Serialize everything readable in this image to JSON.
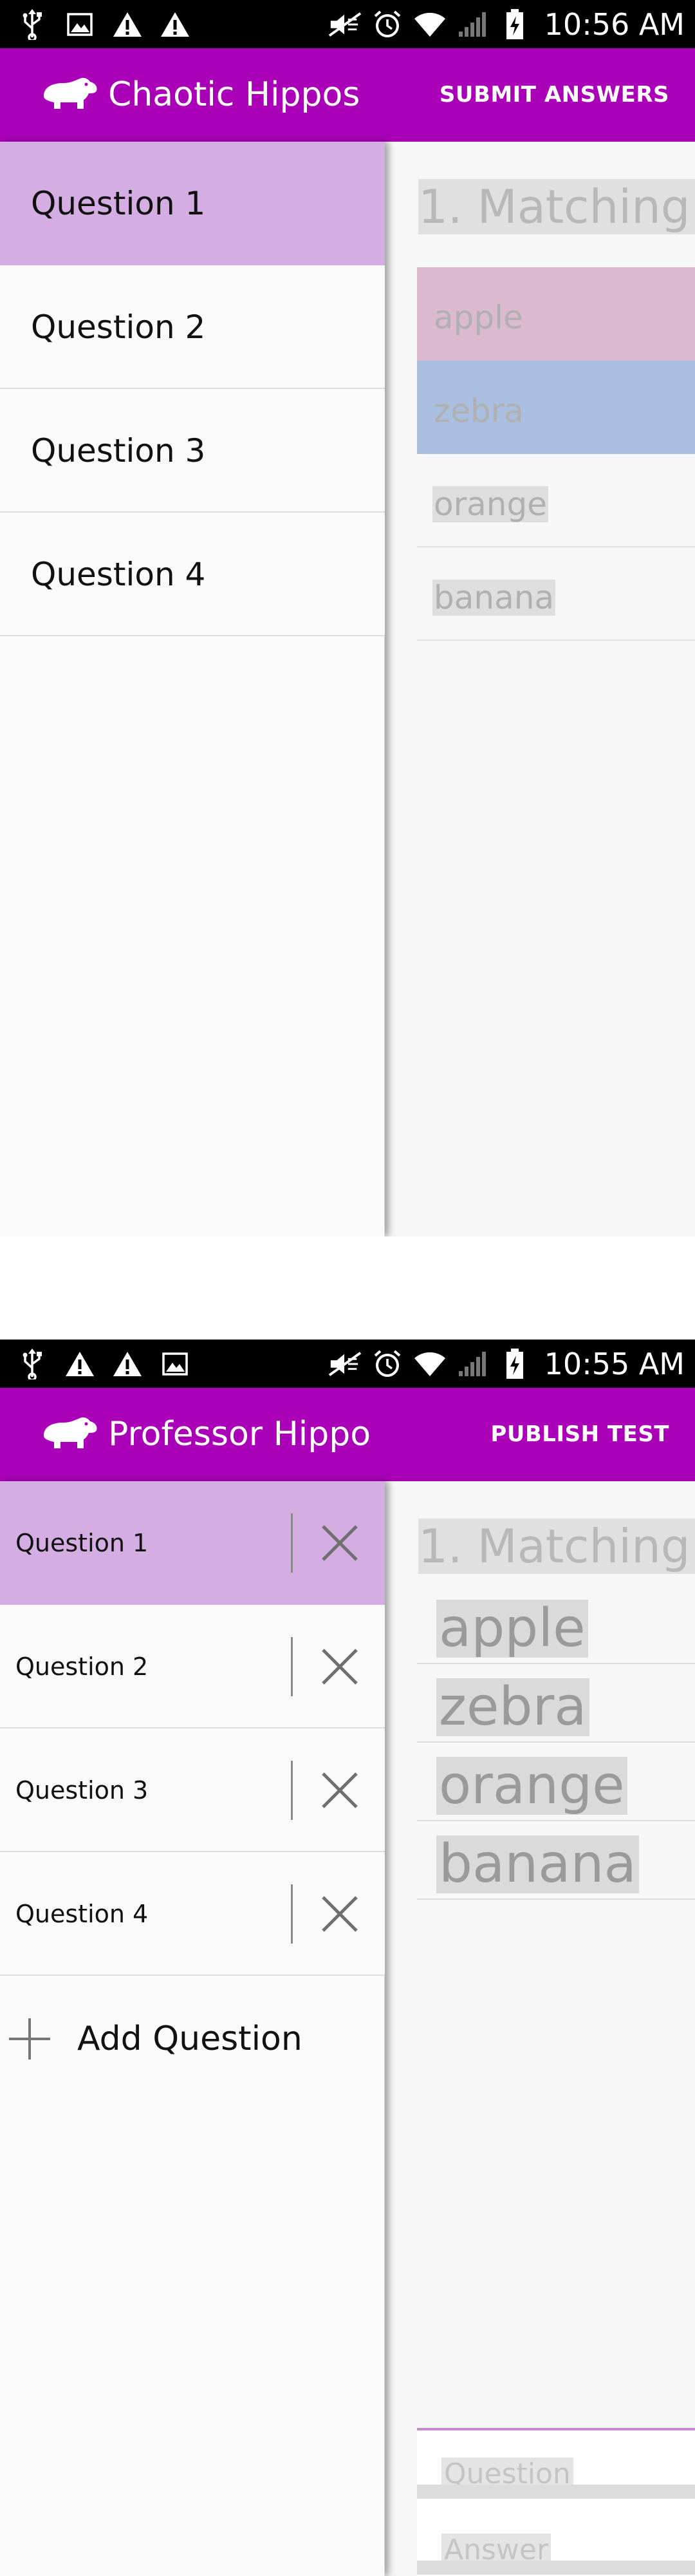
{
  "colors": {
    "appbar": "#aa00b8",
    "active_item": "#d4ade2",
    "match_pink": "#dbb9cf",
    "match_blue": "#aabfdf",
    "accent_line": "#c78bd3"
  },
  "screens": [
    {
      "status": {
        "time": "10:56 AM",
        "left_icons": [
          "usb-icon",
          "image-icon",
          "warning-icon",
          "warning-icon"
        ],
        "right_icons": [
          "mute-icon",
          "alarm-icon",
          "wifi-icon",
          "signal-icon",
          "battery-icon"
        ]
      },
      "appbar": {
        "logo_icon": "hippo-icon",
        "title": "Chaotic Hippos",
        "action": "SUBMIT ANSWERS"
      },
      "drawer": {
        "items": [
          {
            "label": "Question 1",
            "active": true
          },
          {
            "label": "Question 2",
            "active": false
          },
          {
            "label": "Question 3",
            "active": false
          },
          {
            "label": "Question 4",
            "active": false
          }
        ]
      },
      "content": {
        "heading": "1. Matching",
        "options": [
          {
            "text": "apple",
            "color": "#dbb9cf"
          },
          {
            "text": "zebra",
            "color": "#aabfdf"
          },
          {
            "text": "orange",
            "color": ""
          },
          {
            "text": "banana",
            "color": ""
          }
        ]
      }
    },
    {
      "status": {
        "time": "10:55 AM",
        "left_icons": [
          "usb-icon",
          "warning-icon",
          "warning-icon",
          "image-icon"
        ],
        "right_icons": [
          "mute-icon",
          "alarm-icon",
          "wifi-icon",
          "signal-icon",
          "battery-icon"
        ]
      },
      "appbar": {
        "logo_icon": "hippo-icon",
        "title": "Professor Hippo",
        "action": "PUBLISH TEST"
      },
      "drawer": {
        "items": [
          {
            "label": "Question 1",
            "active": true,
            "delete_icon": "close-icon"
          },
          {
            "label": "Question 2",
            "active": false,
            "delete_icon": "close-icon"
          },
          {
            "label": "Question 3",
            "active": false,
            "delete_icon": "close-icon"
          },
          {
            "label": "Question 4",
            "active": false,
            "delete_icon": "close-icon"
          }
        ],
        "add_icon": "plus-icon",
        "add_label": "Add Question"
      },
      "content": {
        "heading": "1. Matching",
        "options": [
          "apple",
          "zebra",
          "orange",
          "banana"
        ],
        "question_placeholder": "Question",
        "answer_placeholder": "Answer"
      }
    }
  ]
}
